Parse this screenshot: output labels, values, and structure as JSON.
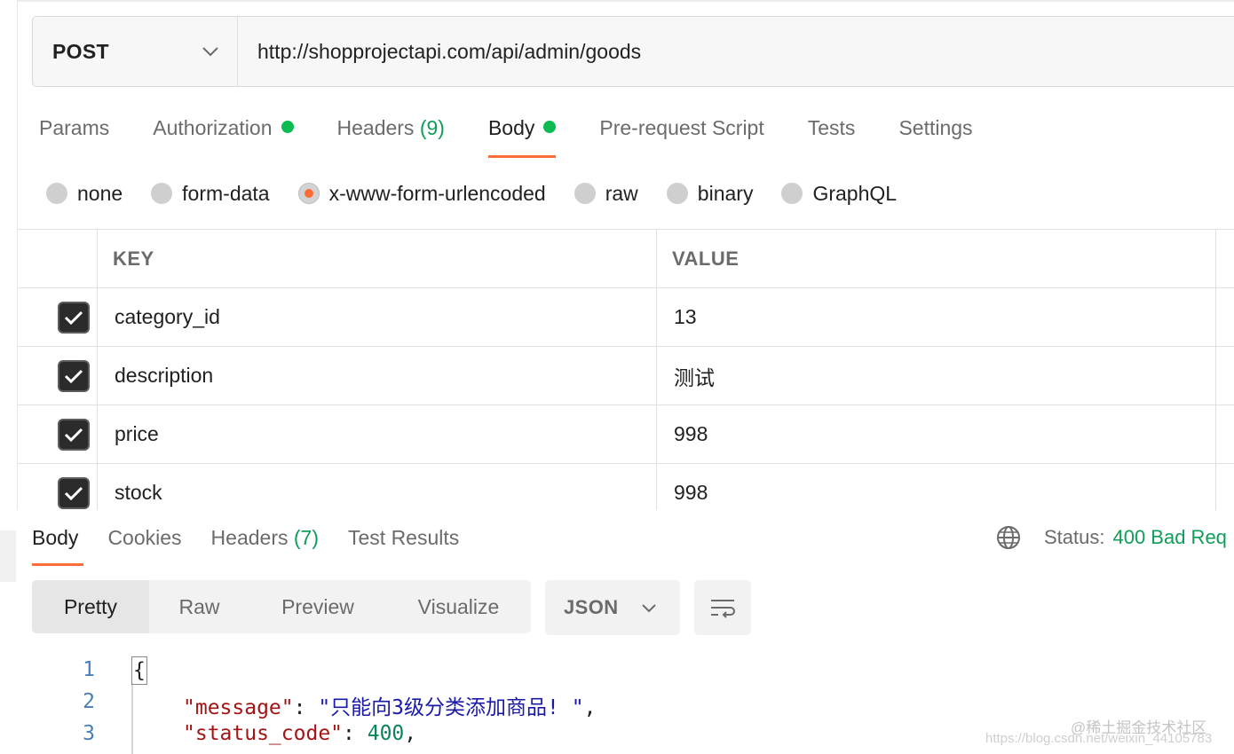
{
  "request": {
    "method": "POST",
    "url": "http://shopprojectapi.com/api/admin/goods"
  },
  "req_tabs": [
    {
      "label": "Params"
    },
    {
      "label": "Authorization",
      "dot": true
    },
    {
      "label": "Headers",
      "count": "(9)"
    },
    {
      "label": "Body",
      "dot": true,
      "active": true
    },
    {
      "label": "Pre-request Script"
    },
    {
      "label": "Tests"
    },
    {
      "label": "Settings"
    }
  ],
  "body_types": [
    "none",
    "form-data",
    "x-www-form-urlencoded",
    "raw",
    "binary",
    "GraphQL"
  ],
  "body_type_selected": "x-www-form-urlencoded",
  "table": {
    "headers": {
      "key": "KEY",
      "value": "VALUE"
    },
    "rows": [
      {
        "checked": true,
        "key": "category_id",
        "value": "13"
      },
      {
        "checked": true,
        "key": "description",
        "value": "测试"
      },
      {
        "checked": true,
        "key": "price",
        "value": "998"
      },
      {
        "checked": true,
        "key": "stock",
        "value": "998"
      }
    ]
  },
  "response": {
    "tabs": {
      "body": "Body",
      "cookies": "Cookies",
      "headers": "Headers",
      "headers_count": "(7)",
      "test_results": "Test Results"
    },
    "status_label": "Status:",
    "status_value": "400 Bad Req",
    "views": [
      "Pretty",
      "Raw",
      "Preview",
      "Visualize"
    ],
    "active_view": "Pretty",
    "format": "JSON",
    "code": {
      "line_numbers": [
        "1",
        "2",
        "3"
      ],
      "brace": "{",
      "message_key": "\"message\"",
      "message_value": "\"只能向3级分类添加商品! \"",
      "status_key": "\"status_code\"",
      "status_value": "400"
    }
  },
  "watermark": {
    "brand": "@稀土掘金技术社区",
    "url": "https://blog.csdn.net/weixin_44105783"
  },
  "colors": {
    "accent": "#ff6c37",
    "success": "#0f9d58",
    "dot": "#0cbb52"
  }
}
